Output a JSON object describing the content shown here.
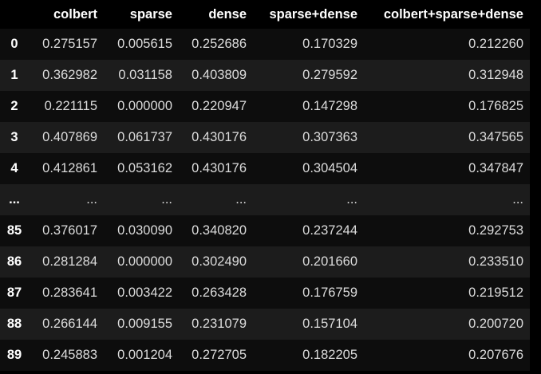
{
  "table": {
    "headers": [
      "",
      "colbert",
      "sparse",
      "dense",
      "sparse+dense",
      "colbert+sparse+dense"
    ],
    "rows": [
      {
        "index": "0",
        "cells": [
          "0.275157",
          "0.005615",
          "0.252686",
          "0.170329",
          "0.212260"
        ]
      },
      {
        "index": "1",
        "cells": [
          "0.362982",
          "0.031158",
          "0.403809",
          "0.279592",
          "0.312948"
        ]
      },
      {
        "index": "2",
        "cells": [
          "0.221115",
          "0.000000",
          "0.220947",
          "0.147298",
          "0.176825"
        ]
      },
      {
        "index": "3",
        "cells": [
          "0.407869",
          "0.061737",
          "0.430176",
          "0.307363",
          "0.347565"
        ]
      },
      {
        "index": "4",
        "cells": [
          "0.412861",
          "0.053162",
          "0.430176",
          "0.304504",
          "0.347847"
        ]
      },
      {
        "index": "...",
        "cells": [
          "...",
          "...",
          "...",
          "...",
          "..."
        ]
      },
      {
        "index": "85",
        "cells": [
          "0.376017",
          "0.030090",
          "0.340820",
          "0.237244",
          "0.292753"
        ]
      },
      {
        "index": "86",
        "cells": [
          "0.281284",
          "0.000000",
          "0.302490",
          "0.201660",
          "0.233510"
        ]
      },
      {
        "index": "87",
        "cells": [
          "0.283641",
          "0.003422",
          "0.263428",
          "0.176759",
          "0.219512"
        ]
      },
      {
        "index": "88",
        "cells": [
          "0.266144",
          "0.009155",
          "0.231079",
          "0.157104",
          "0.200720"
        ]
      },
      {
        "index": "89",
        "cells": [
          "0.245883",
          "0.001204",
          "0.272705",
          "0.182205",
          "0.207676"
        ]
      }
    ]
  },
  "colors": {
    "background": "#000000",
    "row_odd": "#0d0d0d",
    "row_even": "#1c1c1c",
    "header_text": "#ffffff",
    "cell_text": "#dcdcdc"
  }
}
